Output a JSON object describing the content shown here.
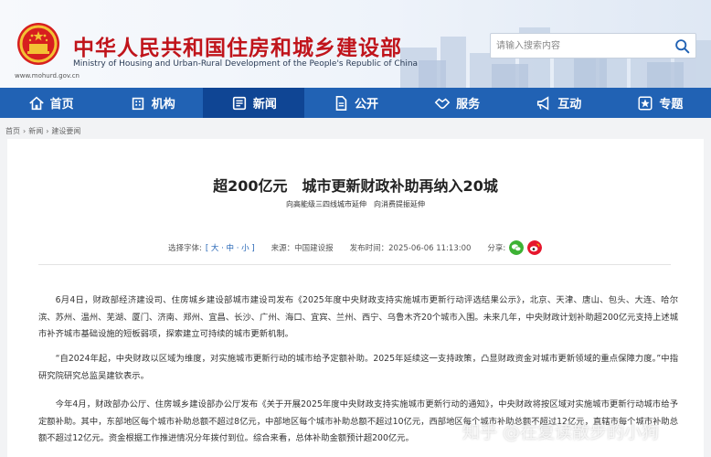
{
  "header": {
    "site_title": "中华人民共和国住房和城乡建设部",
    "site_subtitle": "Ministry of Housing and Urban-Rural Development of the People's Republic of China",
    "site_url": "www.mohurd.gov.cn",
    "search_placeholder": "请输入搜索内容"
  },
  "nav": {
    "items": [
      {
        "label": "首页",
        "icon": "home-icon"
      },
      {
        "label": "机构",
        "icon": "building-icon"
      },
      {
        "label": "新闻",
        "icon": "news-icon",
        "active": true
      },
      {
        "label": "公开",
        "icon": "document-icon"
      },
      {
        "label": "服务",
        "icon": "handshake-icon"
      },
      {
        "label": "互动",
        "icon": "megaphone-icon"
      },
      {
        "label": "专题",
        "icon": "star-icon"
      }
    ],
    "color": "#2162b4",
    "active_color": "#0f4594"
  },
  "breadcrumb": [
    "首页",
    "新闻",
    "建设要闻"
  ],
  "article": {
    "title": "超200亿元　城市更新财政补助再纳入20城",
    "subtitle": "向高能级三四线城市延伸　向消费提振延伸",
    "font_size_label": "选择字体:",
    "font_size_options": "[ 大 · 中 · 小 ]",
    "source": "来源：中国建设报",
    "time": "发布时间：2025-06-06 11:13:00",
    "share_label": "分享:",
    "paragraphs": [
      "6月4日，财政部经济建设司、住房城乡建设部城市建设司发布《2025年度中央财政支持实施城市更新行动评选结果公示》，北京、天津、唐山、包头、大连、哈尔滨、苏州、温州、芜湖、厦门、济南、郑州、宜昌、长沙、广州、海口、宜宾、兰州、西宁、乌鲁木齐20个城市入围。未来几年，中央财政计划补助超200亿元支持上述城市补齐城市基础设施的短板弱项，探索建立可持续的城市更新机制。",
      "“自2024年起，中央财政以区域为维度，对实施城市更新行动的城市给予定额补助。2025年延续这一支持政策，凸显财政资金对城市更新领域的重点保障力度。”中指研究院研究总监吴建钦表示。",
      "今年4月，财政部办公厅、住房城乡建设部办公厅发布《关于开展2025年度中央财政支持实施城市更新行动的通知》，中央财政将按区域对实施城市更新行动城市给予定额补助。其中，东部地区每个城市补助总额不超过8亿元，中部地区每个城市补助总额不超过10亿元，西部地区每个城市补助总额不超过12亿元，直辖市每个城市补助总额不超过12亿元。资金根据工作推进情况分年拨付到位。综合来看，总体补助金额预计超200亿元。"
    ]
  },
  "watermark": "知乎 @在复读散步的小狗"
}
